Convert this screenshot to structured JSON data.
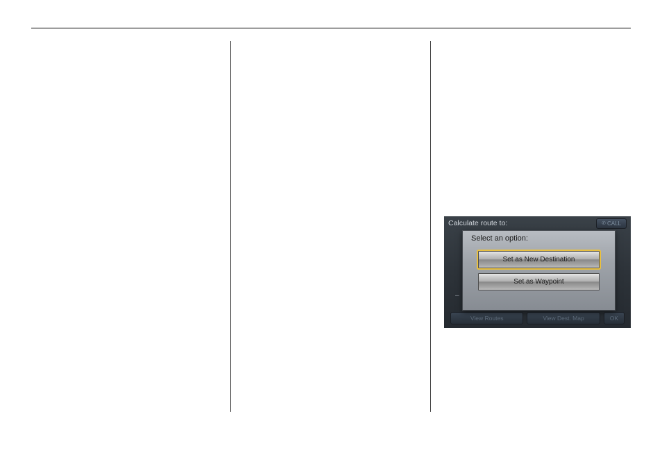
{
  "nav": {
    "header_title": "Calculate route to:",
    "call_label": "CALL",
    "dash": "–",
    "bottom_buttons": {
      "view_routes": "View Routes",
      "view_dest_map": "View Dest. Map",
      "ok": "OK"
    }
  },
  "dialog": {
    "title": "Select an option:",
    "set_destination": "Set as New Destination",
    "set_waypoint": "Set as Waypoint"
  }
}
